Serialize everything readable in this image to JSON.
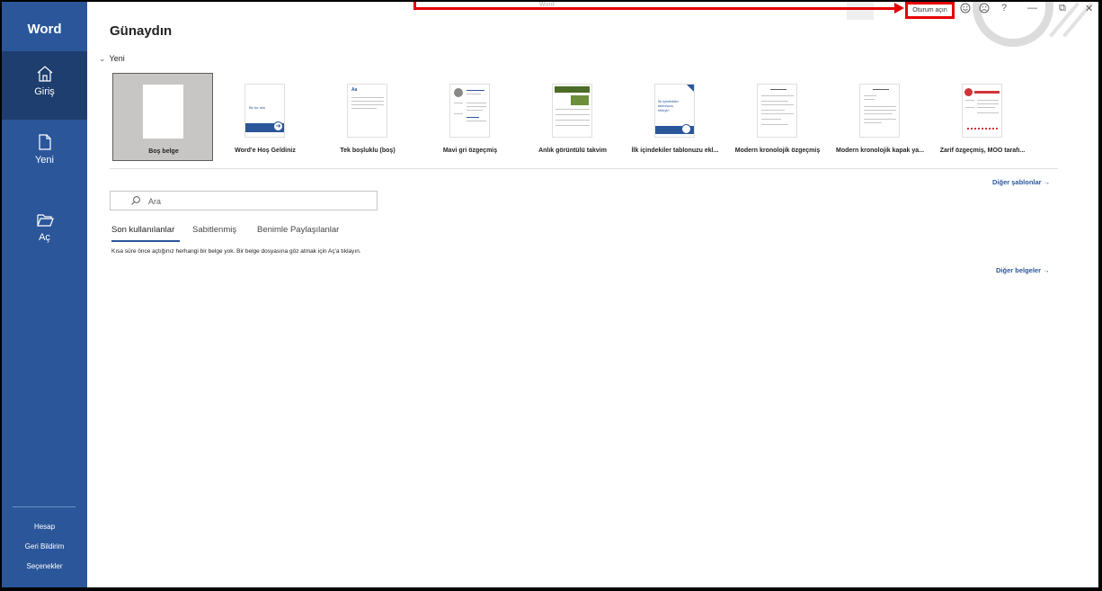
{
  "app": {
    "brand": "Word",
    "window_title": "Word"
  },
  "titlebar": {
    "signin_label": "Oturum açın",
    "help_label": "?",
    "minimize_label": "—",
    "restore_label": "⧉",
    "close_label": "✕"
  },
  "nav": [
    {
      "label": "Giriş",
      "icon": "home-icon",
      "active": true
    },
    {
      "label": "Yeni",
      "icon": "new-document-icon",
      "active": false
    },
    {
      "label": "Aç",
      "icon": "open-folder-icon",
      "active": false
    }
  ],
  "sidebar_bottom": [
    "Hesap",
    "Geri Bildirim",
    "Seçenekler"
  ],
  "main": {
    "greeting": "Günaydın",
    "new_section_label": "Yeni",
    "templates": [
      {
        "label": "Boş belge"
      },
      {
        "label": "Word'e Hoş Geldiniz",
        "thumb_text": "Bir tur alın"
      },
      {
        "label": "Tek boşluklu (boş)",
        "thumb_text": "Aa"
      },
      {
        "label": "Mavi gri özgeçmiş"
      },
      {
        "label": "Anlık görüntülü takvim"
      },
      {
        "label": "İlk içindekiler tablonuzu ekl...",
        "thumb_text": "İlk içindekiler tablonuzu ekleyin"
      },
      {
        "label": "Modern kronolojik özgeçmiş"
      },
      {
        "label": "Modern kronolojik kapak ya..."
      },
      {
        "label": "Zarif özgeçmiş, MOO tarafı..."
      }
    ],
    "more_templates": "Diğer şablonlar →",
    "search_placeholder": "Ara",
    "tabs": [
      "Son kullanılanlar",
      "Sabitlenmiş",
      "Benimle Paylaşılanlar"
    ],
    "empty_message": "Kısa süre önce açtığınız herhangi bir belge yok. Bir belge dosyasına göz atmak için Aç'a tıklayın.",
    "more_documents": "Diğer belgeler →"
  },
  "colors": {
    "accent": "#2b579a",
    "accent_dark": "#1e3e6f",
    "highlight": "#e60000"
  }
}
